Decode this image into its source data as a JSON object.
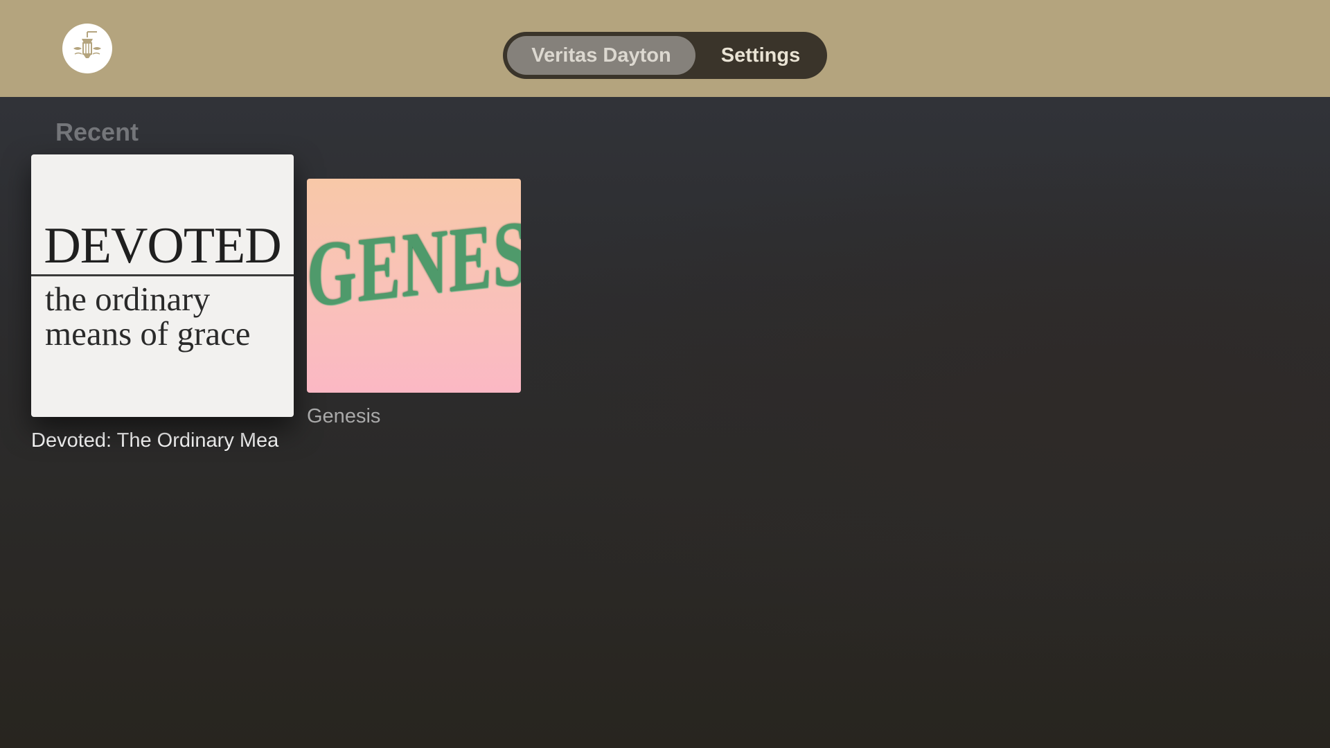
{
  "header": {
    "logo_icon": "lantern-icon",
    "tabs": [
      {
        "label": "Veritas Dayton",
        "active": true
      },
      {
        "label": "Settings",
        "active": false
      }
    ]
  },
  "recent": {
    "title": "Recent",
    "items": [
      {
        "title": "Devoted: The Ordinary Mea",
        "art_heading": "DEVOTED",
        "art_subtitle": "the ordinary means of grace"
      },
      {
        "title": "Genesis",
        "art_heading": "GENESIS"
      }
    ]
  },
  "colors": {
    "header_bg": "#b4a47e",
    "segment_bg": "#3a342a",
    "segment_active": "#85817b",
    "genesis_green": "#4f9a6b"
  }
}
